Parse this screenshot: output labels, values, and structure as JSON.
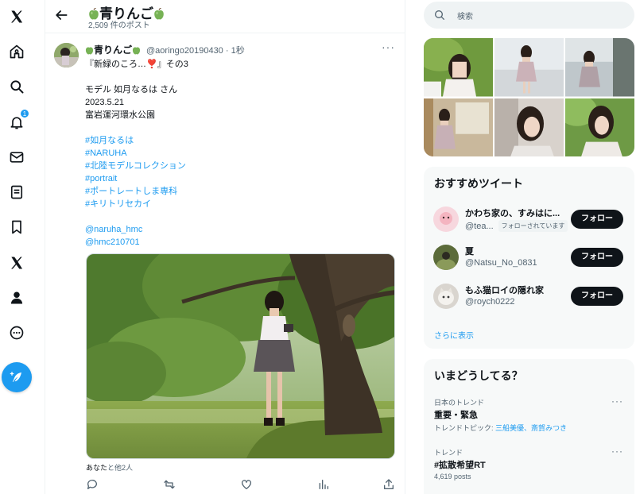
{
  "nav": {
    "items": [
      "x-logo",
      "home",
      "explore",
      "notifications",
      "messages",
      "lists",
      "bookmarks",
      "premium",
      "profile",
      "more"
    ],
    "notification_count": "1"
  },
  "header": {
    "title": "青りんご",
    "post_count": "2,509 件のポスト"
  },
  "tweet": {
    "name": "青りんご",
    "handle_time": "@aoringo20190430 · 1秒",
    "more": "···",
    "lines": [
      {
        "text": "『新緑のころ…",
        "heart": "❣️",
        "tail": "』その3"
      },
      {
        "text": ""
      },
      {
        "text": "モデル 如月なるは さん"
      },
      {
        "text": "2023.5.21"
      },
      {
        "text": "富岩運河環水公園"
      },
      {
        "text": ""
      },
      {
        "text": "#如月なるは",
        "link": true
      },
      {
        "text": "#NARUHA",
        "link": true
      },
      {
        "text": "#北陸モデルコレクション",
        "link": true
      },
      {
        "text": "#portrait",
        "link": true
      },
      {
        "text": "#ポートレートしま専科",
        "link": true
      },
      {
        "text": "#キリトリセカイ",
        "link": true
      },
      {
        "text": ""
      },
      {
        "text": "@naruha_hmc",
        "link": true
      },
      {
        "text": "@hmc210701",
        "link": true
      }
    ],
    "liked_by_you": "あなた",
    "liked_by_rest": "と他2人"
  },
  "right": {
    "search_placeholder": "検索",
    "recommended_title": "おすすめツイート",
    "recommended": [
      {
        "name": "かわち家の、すみはに...",
        "handle": "@tea...",
        "tag": "フォローされています",
        "button": "フォロー"
      },
      {
        "name": "夏",
        "handle": "@Natsu_No_0831",
        "tag": "",
        "button": "フォロー"
      },
      {
        "name": "もふ猫ロイの隠れ家",
        "handle": "@roych0222",
        "tag": "",
        "button": "フォロー"
      }
    ],
    "show_more": "さらに表示",
    "trends_title": "いまどうしてる？",
    "trends": [
      {
        "context": "日本のトレンド",
        "name": "重要・緊急",
        "extra_prefix": "トレンドトピック: ",
        "extra_links": "三船美優、斎賀みつき",
        "more": "···"
      },
      {
        "context": "トレンド",
        "name": "#拡散希望RT",
        "extra_prefix": "4,619 posts",
        "extra_links": "",
        "more": "···"
      }
    ]
  },
  "colors": {
    "accent": "#1d9bf0",
    "text": "#0f1419",
    "muted": "#536471",
    "card_bg": "#f7f9f9"
  }
}
